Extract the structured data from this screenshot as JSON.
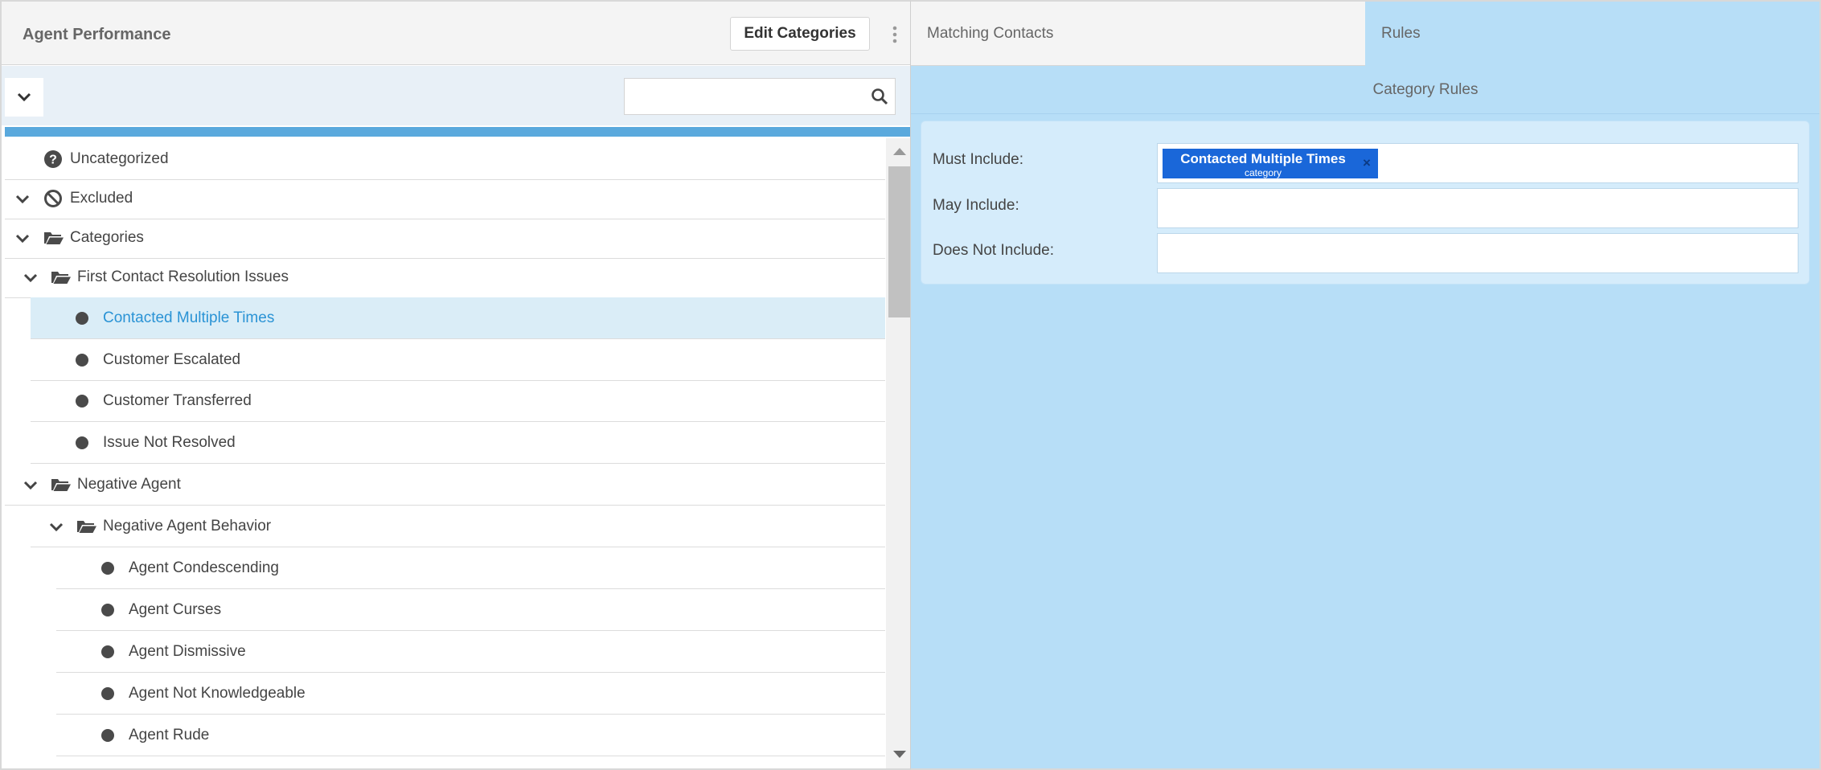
{
  "left": {
    "title": "Agent Performance",
    "edit_button": "Edit Categories",
    "search": {
      "value": "",
      "placeholder": ""
    }
  },
  "tree": {
    "items": [
      {
        "label": "Uncategorized",
        "icon": "question-circle-icon",
        "chevron": false
      },
      {
        "label": "Excluded",
        "icon": "ban-icon",
        "chevron": true
      },
      {
        "label": "Categories",
        "icon": "folder-open-icon",
        "chevron": true
      },
      {
        "label": "First Contact Resolution Issues",
        "icon": "folder-open-icon",
        "chevron": true
      },
      {
        "label": "Contacted Multiple Times",
        "icon": "dot-icon",
        "chevron": false,
        "selected": true
      },
      {
        "label": "Customer Escalated",
        "icon": "dot-icon",
        "chevron": false
      },
      {
        "label": "Customer Transferred",
        "icon": "dot-icon",
        "chevron": false
      },
      {
        "label": "Issue Not Resolved",
        "icon": "dot-icon",
        "chevron": false
      },
      {
        "label": "Negative Agent",
        "icon": "folder-open-icon",
        "chevron": true
      },
      {
        "label": "Negative Agent Behavior",
        "icon": "folder-open-icon",
        "chevron": true
      },
      {
        "label": "Agent Condescending",
        "icon": "dot-icon",
        "chevron": false
      },
      {
        "label": "Agent Curses",
        "icon": "dot-icon",
        "chevron": false
      },
      {
        "label": "Agent Dismissive",
        "icon": "dot-icon",
        "chevron": false
      },
      {
        "label": "Agent Not Knowledgeable",
        "icon": "dot-icon",
        "chevron": false
      },
      {
        "label": "Agent Rude",
        "icon": "dot-icon",
        "chevron": false
      }
    ]
  },
  "right": {
    "tabs": [
      {
        "label": "Matching Contacts",
        "active": false
      },
      {
        "label": "Rules",
        "active": true
      }
    ],
    "header": "Category Rules",
    "rules": {
      "must_include": {
        "label": "Must Include:",
        "chip": {
          "title": "Contacted Multiple Times",
          "subtitle": "category",
          "remove": "×"
        }
      },
      "may_include": {
        "label": "May Include:"
      },
      "does_not_include": {
        "label": "Does Not Include:"
      }
    }
  },
  "colors": {
    "accent": "#5aa9dd",
    "selected_text": "#2a93d5",
    "selected_row": "#daedf7",
    "right_panel": "#b7def7",
    "chip": "#1a67d9"
  }
}
